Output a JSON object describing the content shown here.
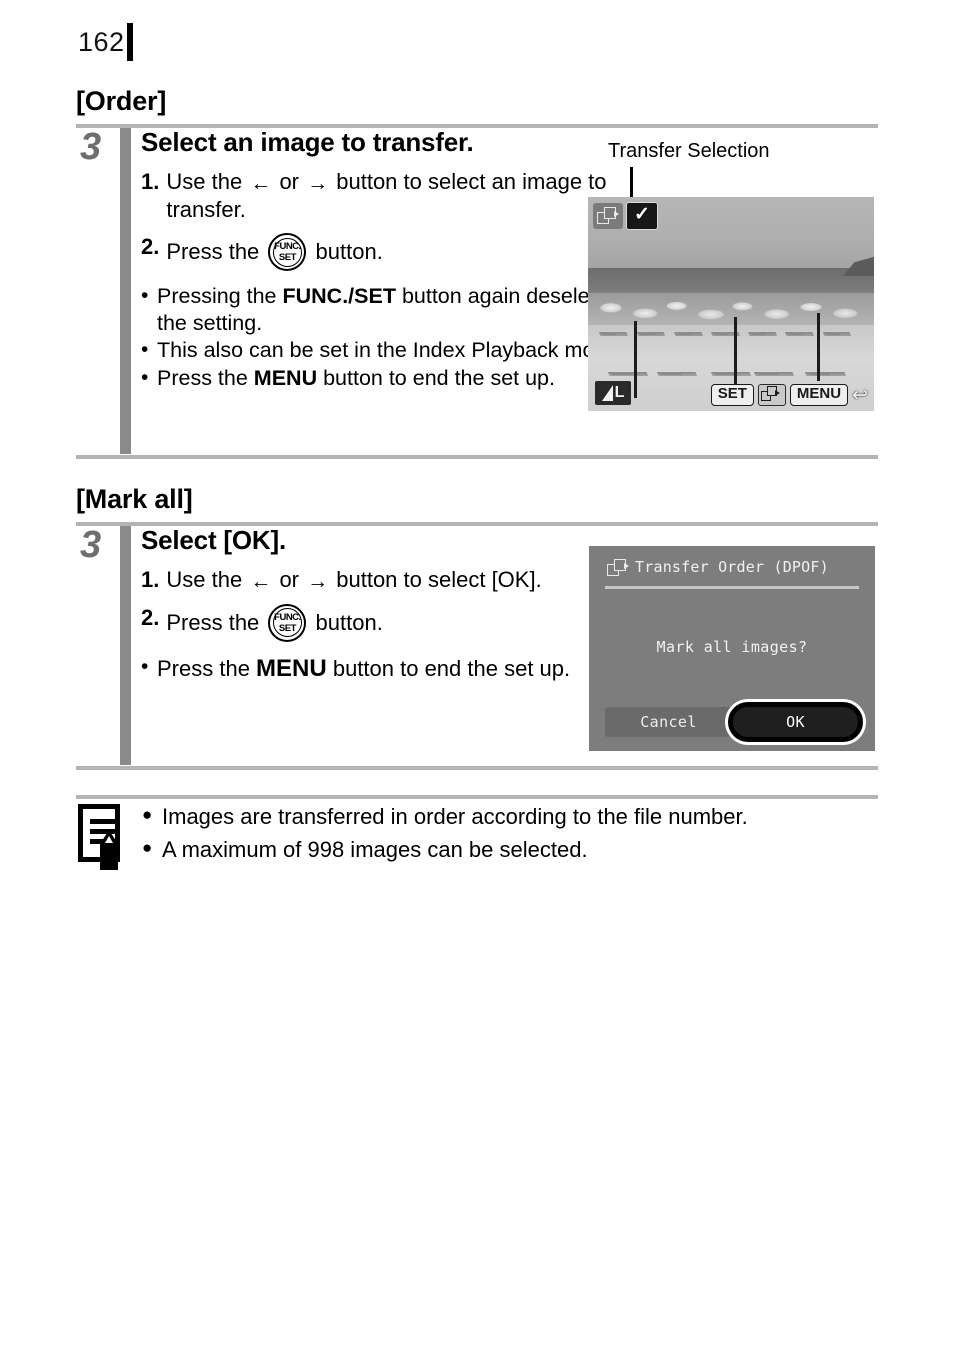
{
  "page": {
    "number": "162"
  },
  "sections": [
    {
      "heading": "[Order]",
      "step_number": "3",
      "step_title": "Select an image to transfer.",
      "substeps": [
        {
          "num": "1.",
          "before": "Use the",
          "arrow_left": "←",
          "mid": "or",
          "arrow_right": "→",
          "after": "button to select an image to transfer."
        },
        {
          "num": "2.",
          "before": "Press the",
          "button": "FUNC./SET",
          "after": "button."
        }
      ],
      "bullets": [
        {
          "dot": "•",
          "pre": "Pressing the ",
          "kw": "FUNC./SET",
          "post": " button again deselects the setting."
        },
        {
          "dot": "•",
          "pre": "This also can be set in the Index Playback mode.",
          "kw": "",
          "post": ""
        },
        {
          "dot": "•",
          "pre": "Press the ",
          "kw": "MENU",
          "post": " button to end the set up."
        }
      ]
    },
    {
      "heading": "[Mark all]",
      "step_number": "3",
      "step_title": "Select [OK].",
      "substeps": [
        {
          "num": "1.",
          "before": "Use the",
          "arrow_left": "←",
          "mid": "or",
          "arrow_right": "→",
          "after": "button to select [OK]."
        },
        {
          "num": "2.",
          "before": "Press the",
          "button": "FUNC./SET",
          "after": "button."
        }
      ],
      "bullets": [
        {
          "dot": "•",
          "pre": "Press the ",
          "kw": "MENU",
          "post": " button to end the set up."
        }
      ]
    }
  ],
  "figures": {
    "photo_screen": {
      "caption": "Transfer Selection",
      "transfer_icon_name": "transfer-order-icon",
      "check_mark": "✓",
      "quality_label": "L",
      "osd_set": "SET",
      "osd_menu": "MENU",
      "osd_return": "↩"
    },
    "dialog_screen": {
      "title": "Transfer Order (DPOF)",
      "message": "Mark all images?",
      "cancel_label": "Cancel",
      "ok_label": "OK"
    }
  },
  "note": {
    "icon_name": "memo-note-icon",
    "items": [
      {
        "dot": "●",
        "text": "Images are transferred in order according to the file number."
      },
      {
        "dot": "●",
        "text": "A maximum of 998 images can be selected."
      }
    ]
  },
  "funcset_button": {
    "top": "FUNC.",
    "bottom": "SET"
  },
  "colors": {
    "rule": "#b4b4b4",
    "step_bar": "#8a8a8a",
    "step_number": "#6e6e6e",
    "screen_bg": "#7d7d7d"
  }
}
